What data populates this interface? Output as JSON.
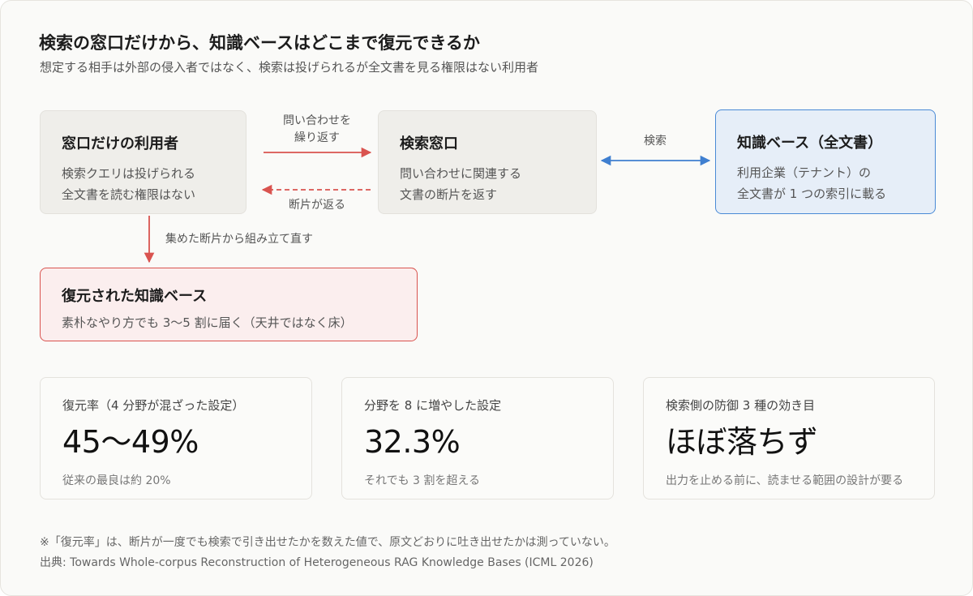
{
  "header": {
    "title": "検索の窓口だけから、知識ベースはどこまで復元できるか",
    "subtitle": "想定する相手は外部の侵入者ではなく、検索は投げられるが全文書を見る権限はない利用者"
  },
  "nodes": {
    "user": {
      "title": "窓口だけの利用者",
      "lines": [
        "検索クエリは投げられる",
        "全文書を読む権限はない"
      ]
    },
    "search": {
      "title": "検索窓口",
      "lines": [
        "問い合わせに関連する",
        "文書の断片を返す"
      ]
    },
    "kb": {
      "title": "知識ベース（全文書）",
      "lines": [
        "利用企業（テナント）の",
        "全文書が 1 つの索引に載る"
      ]
    },
    "reconstructed": {
      "title": "復元された知識ベース",
      "line": "素朴なやり方でも 3〜5 割に届く（天井ではなく床）"
    }
  },
  "edges": {
    "repeat": [
      "問い合わせを",
      "繰り返す"
    ],
    "return": "断片が返る",
    "search": "検索",
    "collect": "集めた断片から組み立て直す"
  },
  "stats": [
    {
      "label": "復元率（4 分野が混ざった設定）",
      "value": "45〜49%",
      "note": "従来の最良は約 20%"
    },
    {
      "label": "分野を 8 に増やした設定",
      "value": "32.3%",
      "note": "それでも 3 割を超える"
    },
    {
      "label": "検索側の防御 3 種の効き目",
      "value": "ほぼ落ちず",
      "note": "出力を止める前に、読ませる範囲の設計が要る"
    }
  ],
  "footer": {
    "note": "※「復元率」は、断片が一度でも検索で引き出せたかを数えた値で、原文どおりに吐き出せたかは測っていない。",
    "source": "出典: Towards Whole-corpus Reconstruction of Heterogeneous RAG Knowledge Bases (ICML 2026)"
  },
  "colors": {
    "red": "#d9534f",
    "blue": "#4a8ad6",
    "gray_box": "#efeeea",
    "blue_box": "#e6eef8",
    "red_box": "#fbeeee"
  }
}
